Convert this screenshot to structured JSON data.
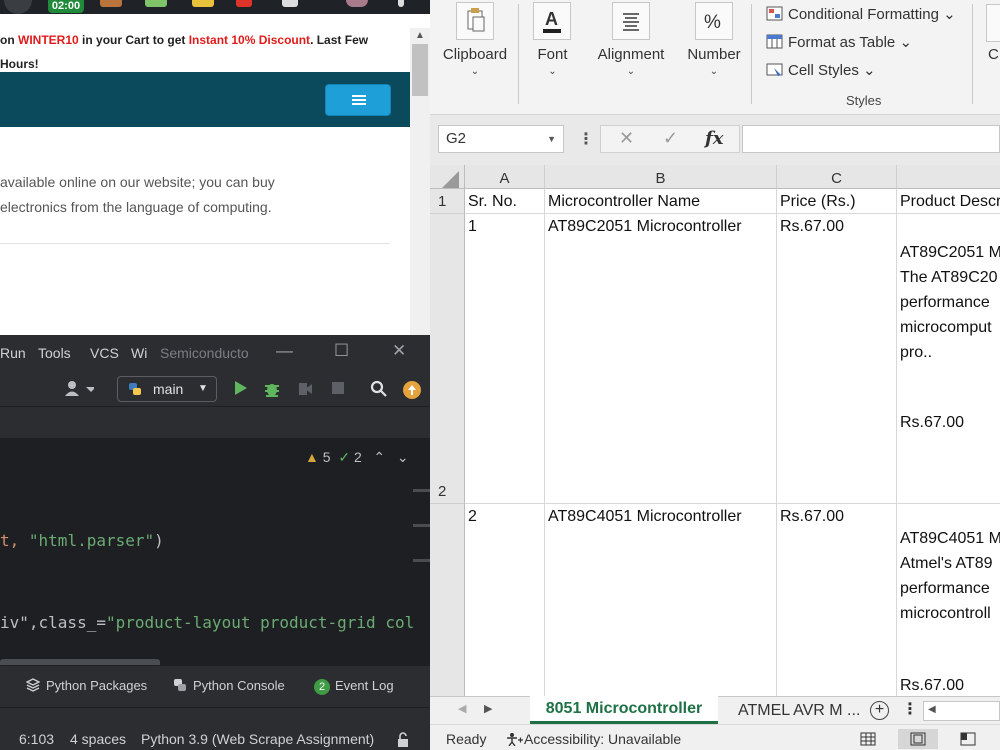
{
  "taskbar": {
    "clock": "02:00"
  },
  "browser": {
    "promo": {
      "pre": "on ",
      "code": "WINTER10",
      "mid": " in your Cart to get ",
      "discount": "Instant 10% Discount",
      "post": ". Last Few",
      "line2": "Hours!"
    },
    "site_text_line1": "available online on our website; you can buy",
    "site_text_line2": "electronics from the language of computing."
  },
  "ide": {
    "menu": [
      "Run",
      "Tools",
      "VCS",
      "Wi"
    ],
    "project_title": "Semiconducto",
    "branch": "main",
    "inspections": {
      "warnings": "5",
      "weak": "2"
    },
    "code": {
      "line1_pre": "t, ",
      "line1_str": "\"html.parser\"",
      "line1_post": ")",
      "line2_pre": "iv\",class_=",
      "line2_str": "\"product-layout product-grid col"
    },
    "bottom_tabs": [
      "Python Packages",
      "Python Console",
      "Event Log"
    ],
    "event_count": "2",
    "status": {
      "position": "6:103",
      "indent": "4 spaces",
      "interpreter": "Python 3.9 (Web Scrape Assignment)"
    }
  },
  "excel": {
    "ribbon": {
      "groups": [
        "Clipboard",
        "Font",
        "Alignment",
        "Number"
      ],
      "cut_group_letter": "C",
      "styles_items": [
        "Conditional Formatting",
        "Format as Table",
        "Cell Styles"
      ],
      "styles_label": "Styles"
    },
    "name_box": "G2",
    "columns": [
      "A",
      "B",
      "C"
    ],
    "header_row": {
      "row": "1",
      "a": "Sr. No.",
      "b": "Microcontroller Name",
      "c": "Price (Rs.)",
      "d": "Product Descr"
    },
    "rows": [
      {
        "row": "2",
        "a": "1",
        "b": "AT89C2051 Microcontroller",
        "c": "Rs.67.00",
        "d_lines": [
          "AT89C2051 M",
          "The AT89C20",
          "performance",
          "microcomput",
          "pro.."
        ],
        "d_price": "Rs.67.00"
      },
      {
        "a": "2",
        "b": "AT89C4051 Microcontroller",
        "c": "Rs.67.00",
        "d_lines": [
          "AT89C4051 M",
          "Atmel's AT89",
          "performance",
          "microcontroll"
        ],
        "d_price": "Rs.67.00"
      }
    ],
    "sheet_tabs": {
      "active": "8051 Microcontroller",
      "other": "ATMEL AVR M ..."
    },
    "status": {
      "ready": "Ready",
      "accessibility": "Accessibility: Unavailable"
    }
  }
}
